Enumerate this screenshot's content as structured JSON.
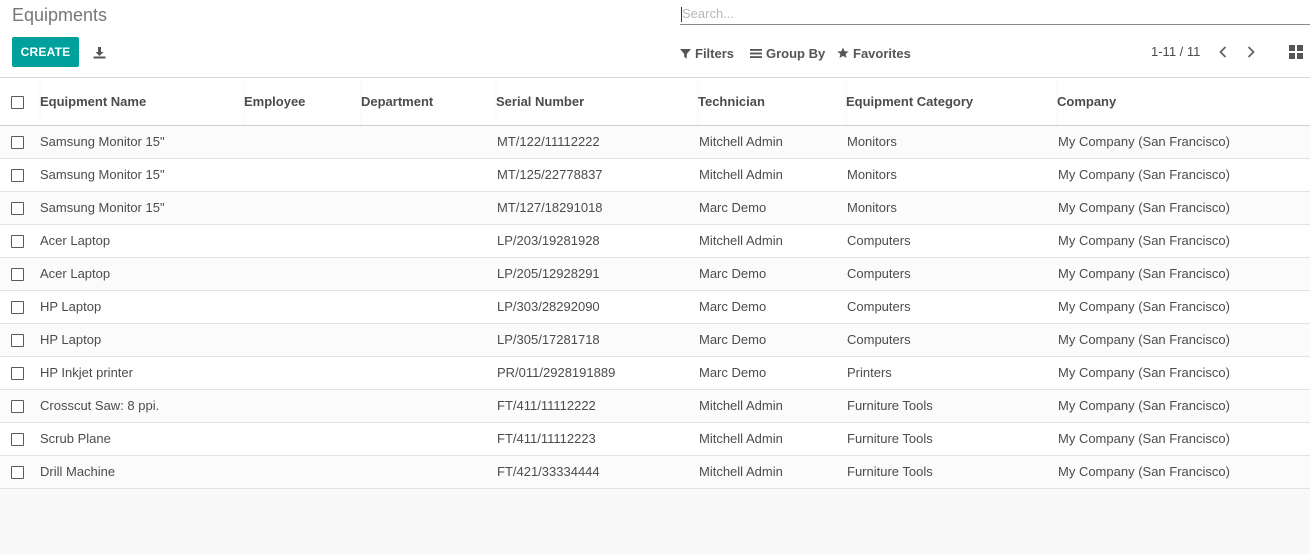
{
  "header": {
    "title": "Equipments",
    "search_placeholder": "Search...",
    "create_label": "CREATE",
    "filters_label": "Filters",
    "groupby_label": "Group By",
    "favorites_label": "Favorites",
    "pager_value": "1-11 / 11"
  },
  "table": {
    "columns": [
      "Equipment Name",
      "Employee",
      "Department",
      "Serial Number",
      "Technician",
      "Equipment Category",
      "Company"
    ],
    "rows": [
      [
        "Samsung Monitor 15\"",
        "",
        "",
        "MT/122/11112222",
        "Mitchell Admin",
        "Monitors",
        "My Company (San Francisco)"
      ],
      [
        "Samsung Monitor 15\"",
        "",
        "",
        "MT/125/22778837",
        "Mitchell Admin",
        "Monitors",
        "My Company (San Francisco)"
      ],
      [
        "Samsung Monitor 15\"",
        "",
        "",
        "MT/127/18291018",
        "Marc Demo",
        "Monitors",
        "My Company (San Francisco)"
      ],
      [
        "Acer Laptop",
        "",
        "",
        "LP/203/19281928",
        "Mitchell Admin",
        "Computers",
        "My Company (San Francisco)"
      ],
      [
        "Acer Laptop",
        "",
        "",
        "LP/205/12928291",
        "Marc Demo",
        "Computers",
        "My Company (San Francisco)"
      ],
      [
        "HP Laptop",
        "",
        "",
        "LP/303/28292090",
        "Marc Demo",
        "Computers",
        "My Company (San Francisco)"
      ],
      [
        "HP Laptop",
        "",
        "",
        "LP/305/17281718",
        "Marc Demo",
        "Computers",
        "My Company (San Francisco)"
      ],
      [
        "HP Inkjet printer",
        "",
        "",
        "PR/011/2928191889",
        "Marc Demo",
        "Printers",
        "My Company (San Francisco)"
      ],
      [
        "Crosscut Saw: 8 ppi.",
        "",
        "",
        "FT/411/11112222",
        "Mitchell Admin",
        "Furniture Tools",
        "My Company (San Francisco)"
      ],
      [
        "Scrub Plane",
        "",
        "",
        "FT/411/11112223",
        "Mitchell Admin",
        "Furniture Tools",
        "My Company (San Francisco)"
      ],
      [
        "Drill Machine",
        "",
        "",
        "FT/421/33334444",
        "Mitchell Admin",
        "Furniture Tools",
        "My Company (San Francisco)"
      ]
    ]
  },
  "icons": {
    "download": "download-icon",
    "filter": "filter-icon",
    "groupby": "list-icon",
    "favorites": "star-icon",
    "prev": "chevron-left-icon",
    "next": "chevron-right-icon",
    "view": "kanban-grid-icon"
  },
  "colors": {
    "primary": "#00a09d",
    "background": "#f9f9f9",
    "text": "#4c4c4c"
  }
}
